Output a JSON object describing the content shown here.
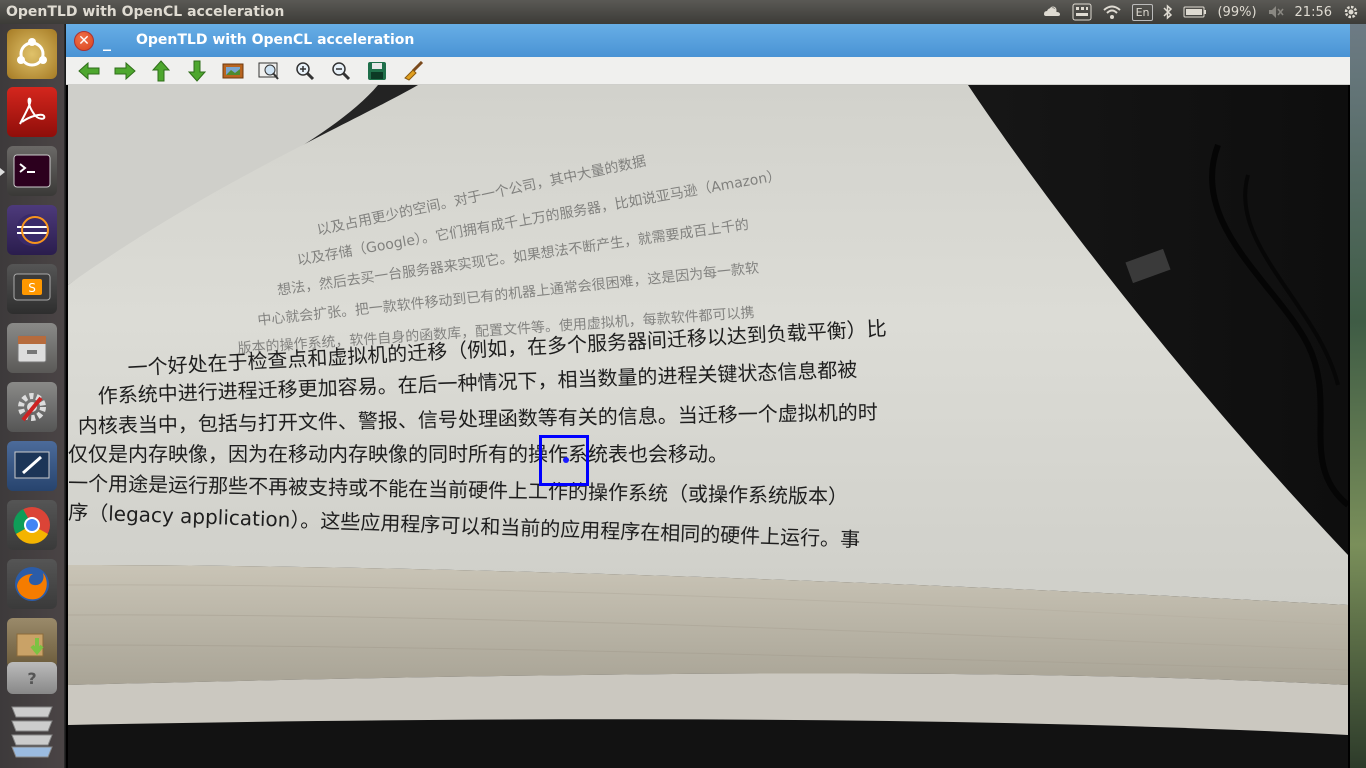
{
  "panel": {
    "title": "OpenTLD with OpenCL acceleration",
    "indicators": {
      "keyboard_layout": "En",
      "battery_percent": "(99%)",
      "clock": "21:56"
    }
  },
  "launcher": {
    "items": [
      {
        "name": "ubuntu-dash",
        "icon": "ubuntu-logo-icon"
      },
      {
        "name": "pdf-reader",
        "icon": "pdf-icon"
      },
      {
        "name": "terminal",
        "icon": "terminal-icon"
      },
      {
        "name": "eclipse",
        "icon": "eclipse-icon"
      },
      {
        "name": "sublime-text",
        "icon": "sublime-icon"
      },
      {
        "name": "file-manager",
        "icon": "files-icon"
      },
      {
        "name": "system-settings",
        "icon": "settings-icon"
      },
      {
        "name": "screen-recorder",
        "icon": "screenshot-icon"
      },
      {
        "name": "chrome",
        "icon": "chrome-icon"
      },
      {
        "name": "firefox",
        "icon": "firefox-icon"
      },
      {
        "name": "software-installer",
        "icon": "install-icon"
      },
      {
        "name": "help",
        "icon": "help-icon"
      },
      {
        "name": "workspaces",
        "icon": "workspaces-icon"
      }
    ]
  },
  "window": {
    "title": "OpenTLD with OpenCL acceleration",
    "toolbar": [
      {
        "name": "back",
        "icon": "arrow-left-icon"
      },
      {
        "name": "forward",
        "icon": "arrow-right-icon"
      },
      {
        "name": "up",
        "icon": "arrow-up-icon"
      },
      {
        "name": "down",
        "icon": "arrow-down-icon"
      },
      {
        "name": "image",
        "icon": "image-icon"
      },
      {
        "name": "zoom-fit",
        "icon": "zoom-fit-icon"
      },
      {
        "name": "zoom-in",
        "icon": "zoom-in-icon"
      },
      {
        "name": "zoom-out",
        "icon": "zoom-out-icon"
      },
      {
        "name": "save",
        "icon": "save-icon"
      },
      {
        "name": "clear",
        "icon": "brush-icon"
      }
    ],
    "frame": {
      "book_lines": [
        "一个好处在于检查点和虚拟机的迁移（例如，在多个服务器间迁移以达到负载平衡）比",
        "作系统中进行进程迁移更加容易。在后一种情况下，相当数量的进程关键状态信息都被",
        "内核表当中，包括与打开文件、警报、信号处理函数等有关的信息。当迁移一个虚拟机的时",
        "仅仅是内存映像，因为在移动内存映像的同时所有的操作系统表也会移动。",
        "一个用途是运行那些不再被支持或不能在当前硬件上工作的操作系统（或操作系统版本）",
        "序（legacy application）。这些应用程序可以和当前的应用程序在相同的硬件上运行。事"
      ],
      "upper_lines": [
        "以及占用更少的空间。对于一个公司，其中大量的数据",
        "以及存储（Google）。它们拥有成千上万的服务器，比如说亚马逊（Amazon）",
        "想法，然后去买一台服务器来实现它。如果想法不断产生，就需要成百上千的",
        "中心就会扩张。把一款软件移动到已有的机器上通常会很困难，这是因为每一款软",
        "版本的操作系统，软件自身的函数库，配置文件等。使用虚拟机，每款软件都可以携"
      ]
    }
  }
}
